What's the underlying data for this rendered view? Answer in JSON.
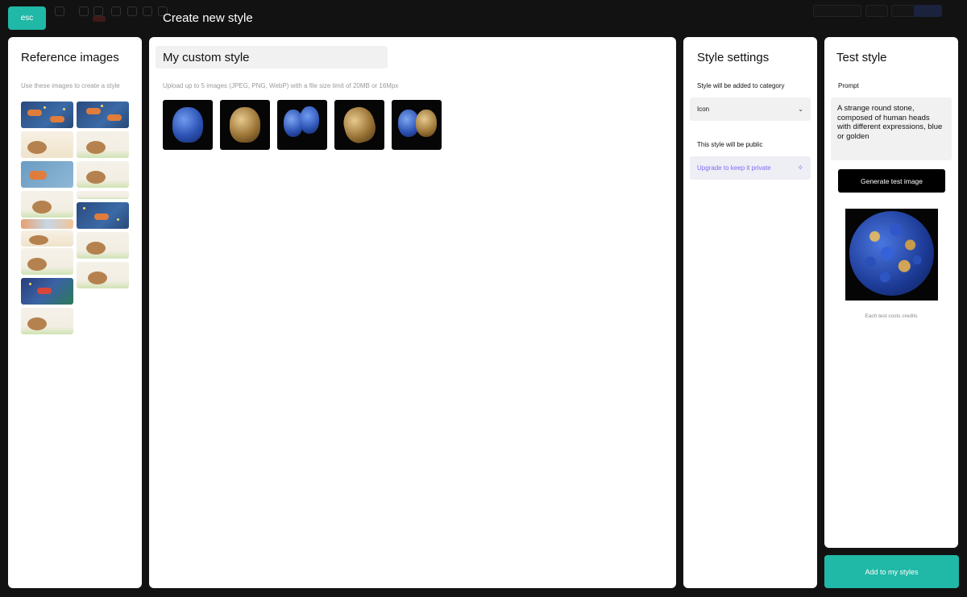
{
  "modal": {
    "esc_label": "esc",
    "title": "Create new style"
  },
  "reference": {
    "heading": "Reference images",
    "hint": "Use these images to create a style"
  },
  "upload": {
    "style_name": "My custom style",
    "hint": "Upload up to 5 images (JPEG, PNG, WebP) with a file size limit of 20MB or 16Mpx"
  },
  "settings": {
    "heading": "Style settings",
    "category_label": "Style will be added to category",
    "category_value": "Icon",
    "visibility_label": "This style will be public",
    "upgrade_label": "Upgrade to keep it private"
  },
  "test": {
    "heading": "Test style",
    "prompt_label": "Prompt",
    "prompt_text": "A strange round stone, composed of human heads with different expressions, blue or golden",
    "generate_label": "Generate test image",
    "credits_note": "Each test costs credits"
  },
  "footer": {
    "add_label": "Add to my styles"
  },
  "colors": {
    "accent": "#20b8a6",
    "upgrade": "#7b6cf6",
    "backdrop": "#121212"
  }
}
